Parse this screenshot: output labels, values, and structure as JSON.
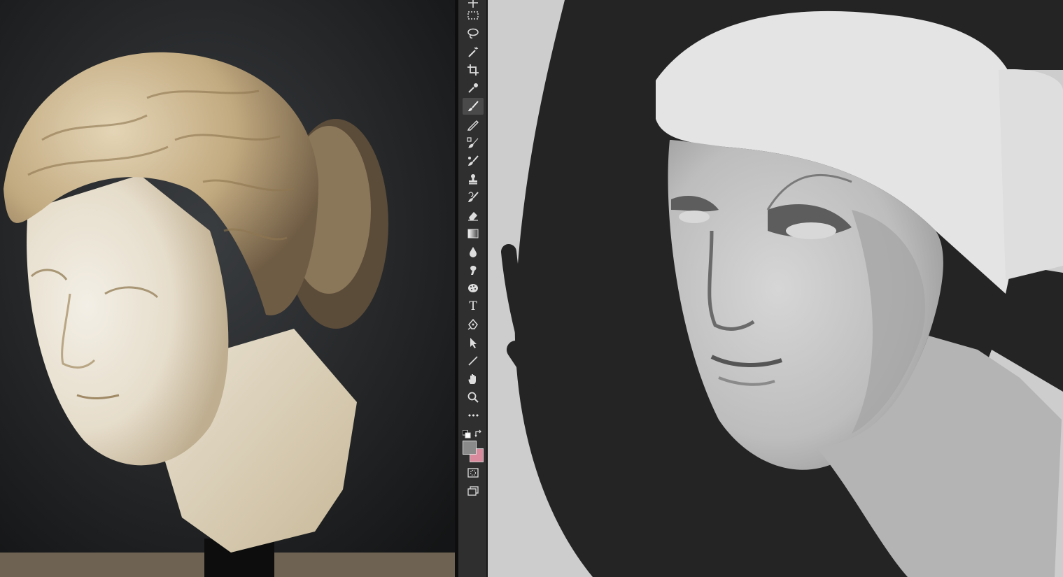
{
  "reference_panel": {
    "subject": "marble-head-photo"
  },
  "toolbar": {
    "tools": [
      {
        "name": "move-tool-icon"
      },
      {
        "name": "rectangular-marquee-tool-icon"
      },
      {
        "name": "lasso-tool-icon"
      },
      {
        "name": "magic-wand-tool-icon"
      },
      {
        "name": "crop-tool-icon"
      },
      {
        "name": "eyedropper-tool-icon"
      },
      {
        "name": "brush-tool-icon",
        "active": true
      },
      {
        "name": "pencil-tool-icon"
      },
      {
        "name": "color-replacement-tool-icon"
      },
      {
        "name": "mixer-brush-tool-icon"
      },
      {
        "name": "clone-stamp-tool-icon"
      },
      {
        "name": "history-brush-tool-icon"
      },
      {
        "name": "eraser-tool-icon"
      },
      {
        "name": "gradient-tool-icon"
      },
      {
        "name": "blur-tool-icon"
      },
      {
        "name": "smudge-tool-icon"
      },
      {
        "name": "sponge-tool-icon"
      },
      {
        "name": "type-tool-icon"
      },
      {
        "name": "pen-tool-icon"
      },
      {
        "name": "path-selection-tool-icon"
      },
      {
        "name": "line-tool-icon"
      },
      {
        "name": "hand-tool-icon"
      },
      {
        "name": "zoom-tool-icon"
      },
      {
        "name": "more-tools-icon"
      }
    ],
    "type_glyph": "T",
    "more_glyph": "•••",
    "foreground_color": "#8a8a8a",
    "background_color": "#d98a9c"
  },
  "canvas": {
    "subject": "grayscale-painting-study"
  }
}
